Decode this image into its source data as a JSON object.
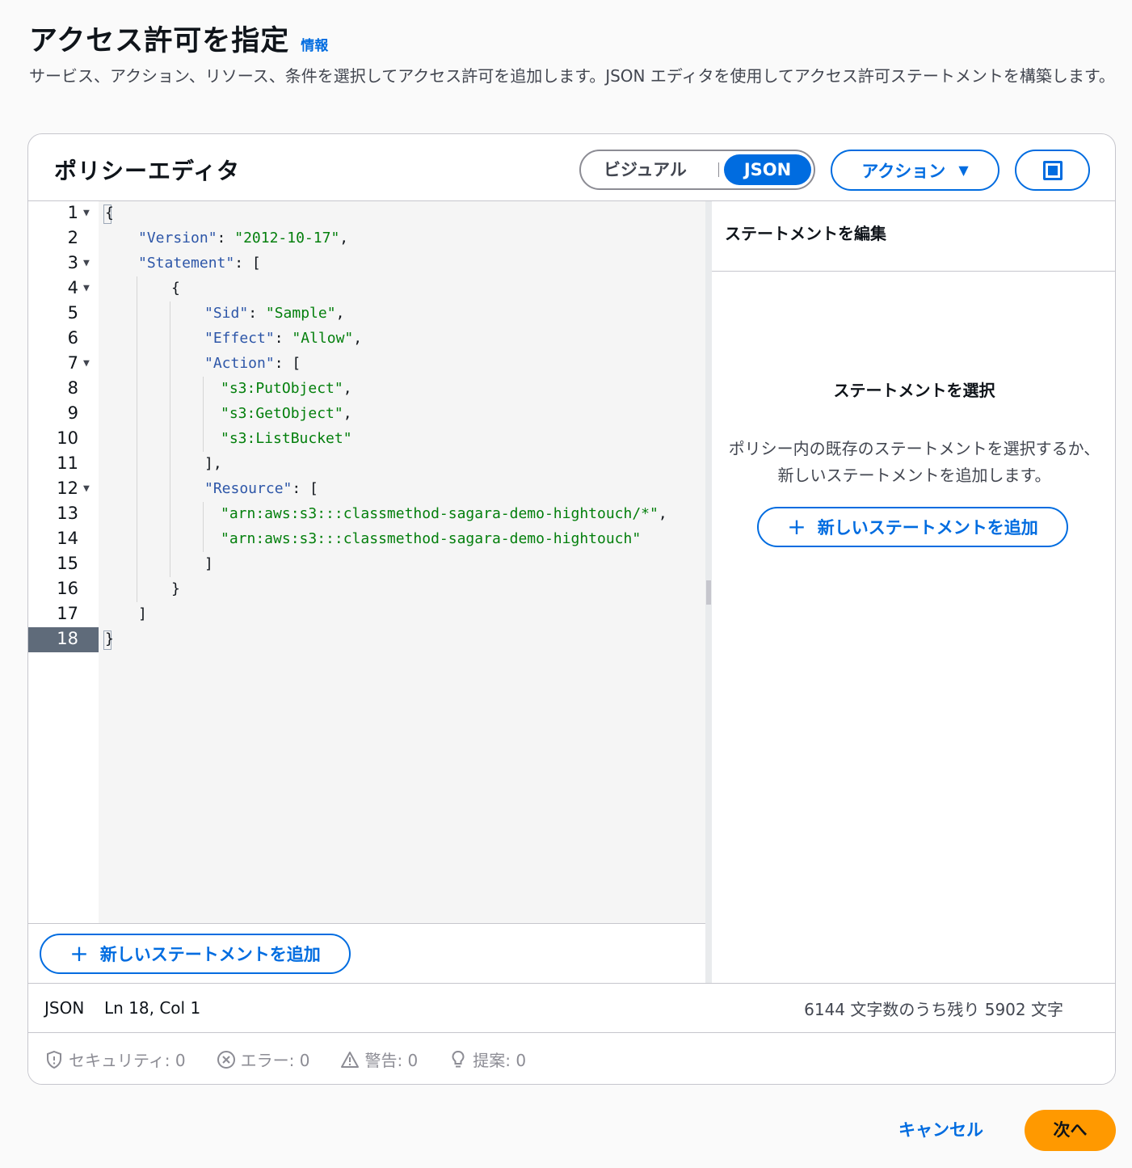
{
  "page": {
    "title": "アクセス許可を指定",
    "info_link": "情報",
    "description": "サービス、アクション、リソース、条件を選択してアクセス許可を追加します。JSON エディタを使用してアクセス許可ステートメントを構築します。"
  },
  "editor": {
    "title": "ポリシーエディタ",
    "mode_visual": "ビジュアル",
    "mode_json": "JSON",
    "selected_mode": "JSON",
    "actions_label": "アクション",
    "add_statement_label": "新しいステートメントを追加",
    "code_lines": [
      {
        "n": "1"
      },
      {
        "n": "2"
      },
      {
        "n": "3"
      },
      {
        "n": "4"
      },
      {
        "n": "5"
      },
      {
        "n": "6"
      },
      {
        "n": "7"
      },
      {
        "n": "8"
      },
      {
        "n": "9"
      },
      {
        "n": "10"
      },
      {
        "n": "11"
      },
      {
        "n": "12"
      },
      {
        "n": "13"
      },
      {
        "n": "14"
      },
      {
        "n": "15"
      },
      {
        "n": "16"
      },
      {
        "n": "17"
      },
      {
        "n": "18"
      }
    ],
    "tokens": {
      "version_key": "\"Version\"",
      "version_val": "\"2012-10-17\"",
      "statement_key": "\"Statement\"",
      "sid_key": "\"Sid\"",
      "sid_val": "\"Sample\"",
      "effect_key": "\"Effect\"",
      "effect_val": "\"Allow\"",
      "action_key": "\"Action\"",
      "action_1": "\"s3:PutObject\"",
      "action_2": "\"s3:GetObject\"",
      "action_3": "\"s3:ListBucket\"",
      "resource_key": "\"Resource\"",
      "resource_1": "\"arn:aws:s3:::classmethod-sagara-demo-hightouch/*\"",
      "resource_2": "\"arn:aws:s3:::classmethod-sagara-demo-hightouch\""
    }
  },
  "side_panel": {
    "header": "ステートメントを編集",
    "empty_title": "ステートメントを選択",
    "empty_description": "ポリシー内の既存のステートメントを選択するか、新しいステートメントを追加します。",
    "add_statement_label": "新しいステートメントを追加"
  },
  "status_bar": {
    "mode": "JSON",
    "position": "Ln 18, Col 1",
    "char_count": "6144 文字数のうち残り 5902 文字"
  },
  "validation": {
    "security": "セキュリティ: 0",
    "errors": "エラー: 0",
    "warnings": "警告: 0",
    "suggestions": "提案: 0"
  },
  "footer": {
    "cancel_label": "キャンセル",
    "next_label": "次へ"
  },
  "colors": {
    "accent": "#006ce0",
    "primary_button": "#ff9900",
    "json_key": "#2d56a8",
    "json_string": "#037f0c"
  }
}
